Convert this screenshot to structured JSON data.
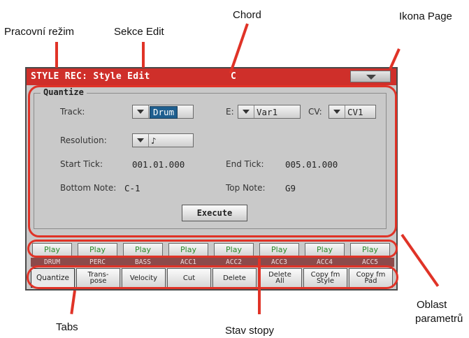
{
  "callouts": {
    "mode": "Pracovní režim",
    "edit_section": "Sekce Edit",
    "chord": "Chord",
    "page_icon": "Ikona Page",
    "param_area_line1": "Oblast",
    "param_area_line2": "parametrů",
    "tabs": "Tabs",
    "track_status": "Stav stopy"
  },
  "header": {
    "title": "STYLE REC: Style Edit",
    "chord": "C"
  },
  "quantize": {
    "group_title": "Quantize",
    "track_label": "Track:",
    "track_value": "Drum",
    "e_label": "E:",
    "e_value": "Var1",
    "cv_label": "CV:",
    "cv_value": "CV1",
    "resolution_label": "Resolution:",
    "resolution_value": "♪",
    "start_tick_label": "Start Tick:",
    "start_tick_value": "001.01.000",
    "end_tick_label": "End Tick:",
    "end_tick_value": "005.01.000",
    "bottom_note_label": "Bottom Note:",
    "bottom_note_value": "C-1",
    "top_note_label": "Top Note:",
    "top_note_value": "G9",
    "execute_label": "Execute"
  },
  "tracks": [
    {
      "status": "Play",
      "name": "DRUM"
    },
    {
      "status": "Play",
      "name": "PERC"
    },
    {
      "status": "Play",
      "name": "BASS"
    },
    {
      "status": "Play",
      "name": "ACC1"
    },
    {
      "status": "Play",
      "name": "ACC2"
    },
    {
      "status": "Play",
      "name": "ACC3"
    },
    {
      "status": "Play",
      "name": "ACC4"
    },
    {
      "status": "Play",
      "name": "ACC5"
    }
  ],
  "tabs": [
    {
      "label": "Quantize",
      "active": true
    },
    {
      "label": "Trans-\npose",
      "active": false
    },
    {
      "label": "Velocity",
      "active": false
    },
    {
      "label": "Cut",
      "active": false
    },
    {
      "label": "Delete",
      "active": false
    },
    {
      "label": "Delete\nAll",
      "active": false
    },
    {
      "label": "Copy fm\nStyle",
      "active": false
    },
    {
      "label": "Copy fm\nPad",
      "active": false
    }
  ],
  "colors": {
    "accent_red": "#e03327",
    "header_red": "#cf2f2a",
    "play_green": "#2a8a2a",
    "selected_blue": "#1f5f8f"
  },
  "icons": {
    "page": "triangle-down-icon",
    "dropdown": "triangle-down-icon"
  }
}
